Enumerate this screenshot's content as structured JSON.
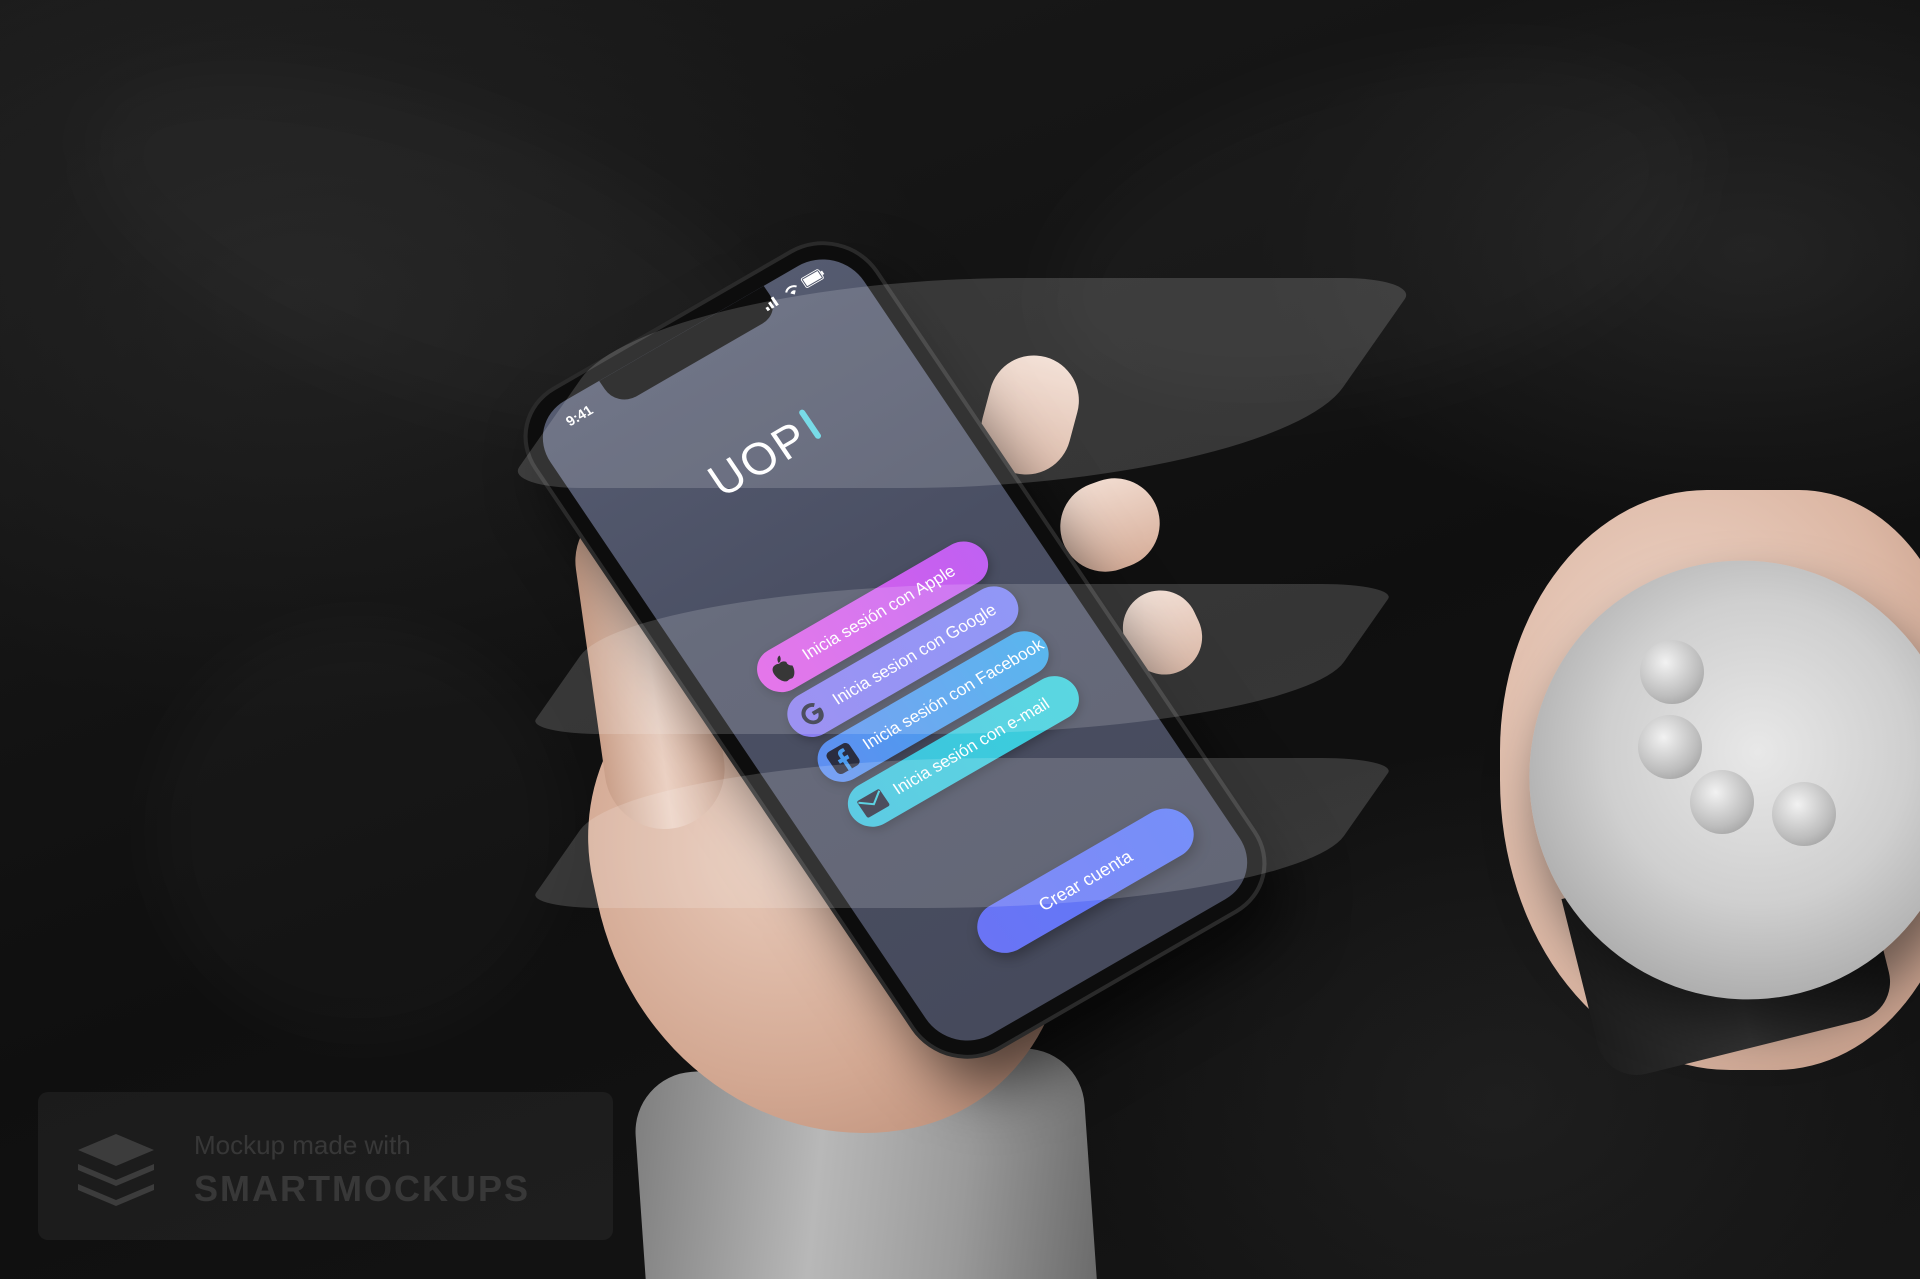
{
  "phone": {
    "status_time": "9:41",
    "status_icons": "signal-wifi-battery",
    "app_logo": "UOP",
    "buttons": {
      "apple": "Inicia sesión con Apple",
      "google": "Inicia sesion con Google",
      "facebook": "Inicia sesión con Facebook",
      "email": "Inicia sesión con e-mail",
      "create_account": "Crear cuenta"
    }
  },
  "watermark": {
    "line1": "Mockup made with",
    "line2": "SMARTMOCKUPS"
  },
  "colors": {
    "apple_button": "#d65ef0",
    "google_button": "#8480f2",
    "facebook_button": "#4a9bee",
    "email_button": "#3dcadd",
    "create_button": "#6676f6",
    "screen_bg": "#4c5165",
    "logo_accent": "#5fd4e3"
  },
  "icons": {
    "apple": "apple-icon",
    "google": "google-icon",
    "facebook": "facebook-icon",
    "email": "envelope-icon",
    "watermark": "layers-icon"
  }
}
